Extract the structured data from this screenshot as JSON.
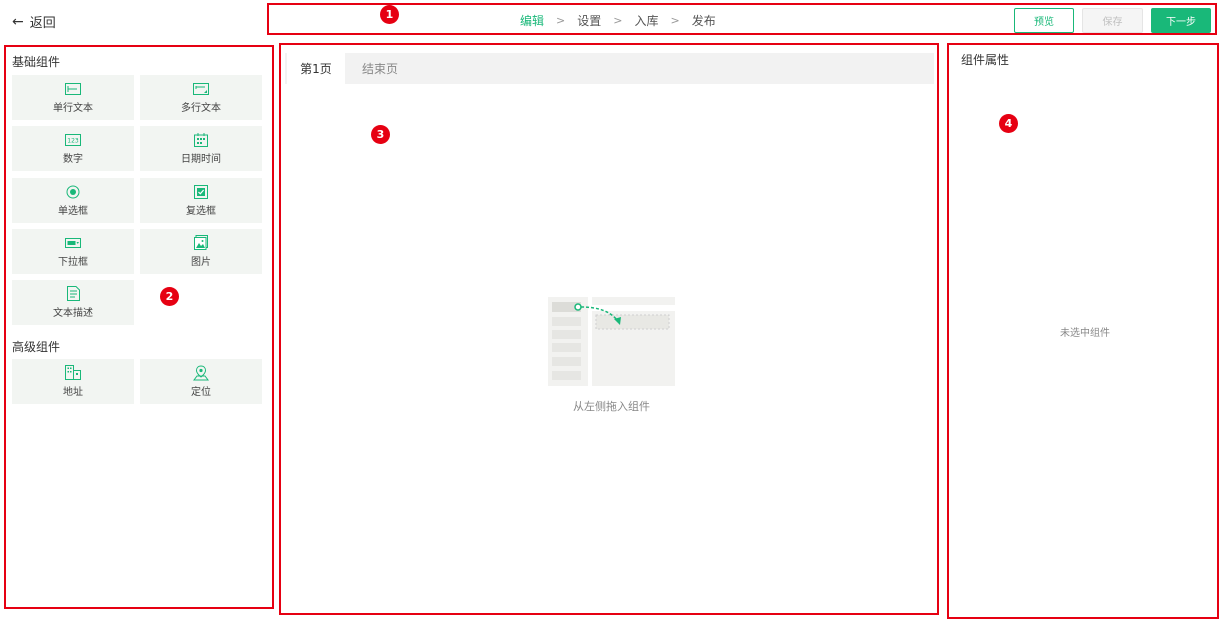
{
  "header": {
    "back_label": "返回",
    "steps": [
      "编辑",
      "设置",
      "入库",
      "发布"
    ],
    "active_step": "编辑",
    "buttons": {
      "preview": "预览",
      "save": "保存",
      "next": "下一步"
    }
  },
  "annotations": [
    "1",
    "2",
    "3",
    "4"
  ],
  "left_panel": {
    "basic_title": "基础组件",
    "basic_items": [
      {
        "label": "单行文本",
        "icon": "single-line-text-icon"
      },
      {
        "label": "多行文本",
        "icon": "multi-line-text-icon"
      },
      {
        "label": "数字",
        "icon": "number-icon"
      },
      {
        "label": "日期时间",
        "icon": "calendar-icon"
      },
      {
        "label": "单选框",
        "icon": "radio-icon"
      },
      {
        "label": "复选框",
        "icon": "checkbox-icon"
      },
      {
        "label": "下拉框",
        "icon": "dropdown-icon"
      },
      {
        "label": "图片",
        "icon": "image-icon"
      },
      {
        "label": "文本描述",
        "icon": "text-description-icon"
      }
    ],
    "advanced_title": "高级组件",
    "advanced_items": [
      {
        "label": "地址",
        "icon": "address-icon"
      },
      {
        "label": "定位",
        "icon": "location-icon"
      }
    ]
  },
  "center": {
    "tabs": [
      "第1页",
      "结束页"
    ],
    "empty_hint": "从左侧拖入组件"
  },
  "right_panel": {
    "title": "组件属性",
    "empty_text": "未选中组件"
  },
  "colors": {
    "accent": "#19b879",
    "annotation": "#e60012"
  }
}
